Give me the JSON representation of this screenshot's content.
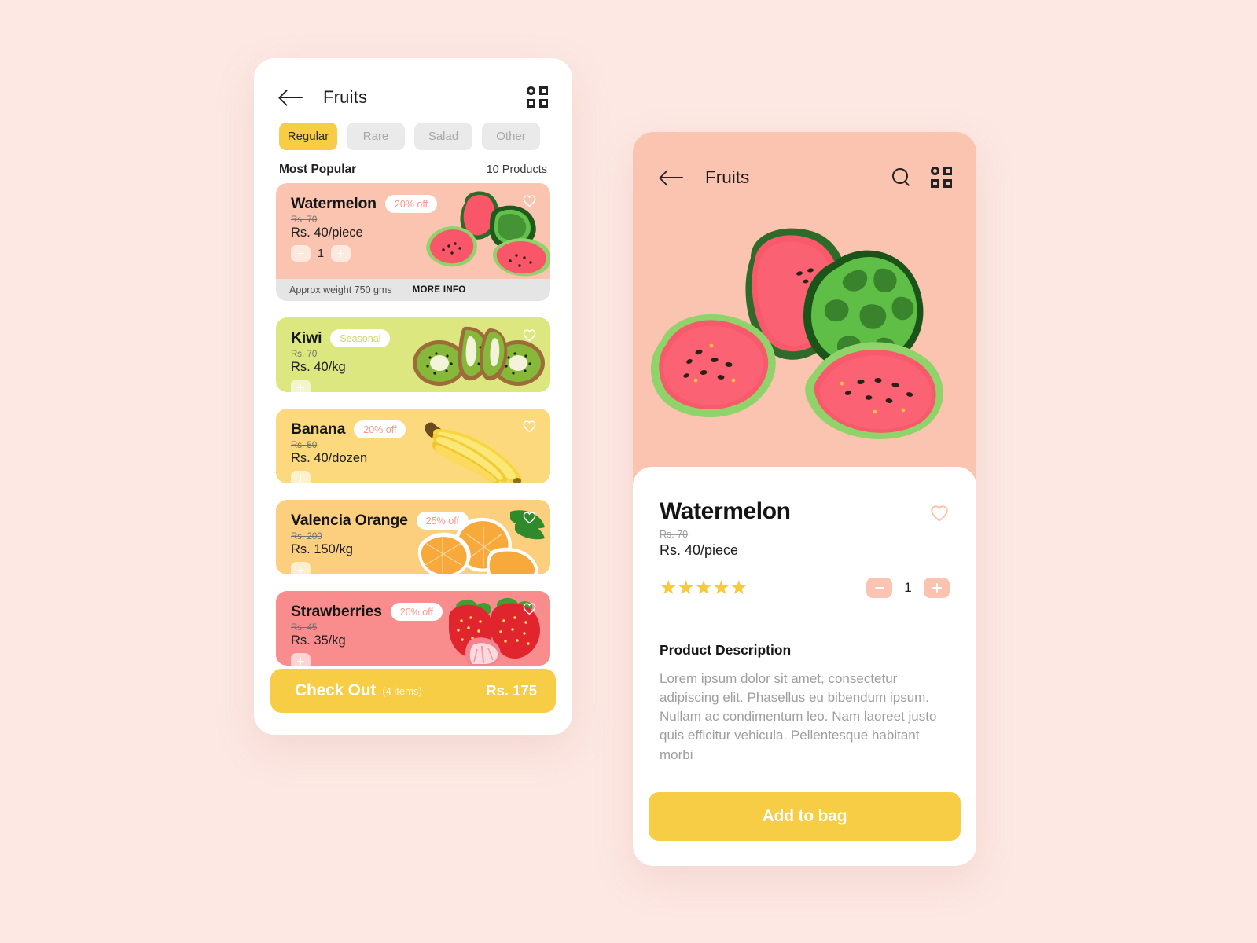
{
  "background_color": "#FDE8E3",
  "list_screen": {
    "back_label": "back-arrow",
    "title": "Fruits",
    "tabs": [
      {
        "label": "Regular",
        "active": true
      },
      {
        "label": "Rare",
        "active": false
      },
      {
        "label": "Salad",
        "active": false
      },
      {
        "label": "Other",
        "active": false
      }
    ],
    "section_title": "Most Popular",
    "product_count": "10 Products",
    "products": [
      {
        "name": "Watermelon",
        "badge": "20% off",
        "badge_type": "off",
        "old_price": "Rs. 70",
        "price": "Rs. 40/piece",
        "quantity": "1",
        "has_stepper": true,
        "card_color": "#FBC4B0",
        "footer": {
          "approx": "Approx weight 750 gms",
          "more_info": "MORE INFO"
        }
      },
      {
        "name": "Kiwi",
        "badge": "Seasonal",
        "badge_type": "seasonal",
        "old_price": "Rs. 70",
        "price": "Rs. 40/kg",
        "has_stepper": false,
        "card_color": "#DCE87F"
      },
      {
        "name": "Banana",
        "badge": "20% off",
        "badge_type": "off",
        "old_price": "Rs. 50",
        "price": "Rs. 40/dozen",
        "has_stepper": false,
        "card_color": "#FBD97C"
      },
      {
        "name": "Valencia Orange",
        "badge": "25% off",
        "badge_type": "off",
        "old_price": "Rs. 200",
        "price": "Rs. 150/kg",
        "has_stepper": false,
        "card_color": "#FCCF7F"
      },
      {
        "name": "Strawberries",
        "badge": "20% off",
        "badge_type": "off",
        "old_price": "Rs. 45",
        "price": "Rs. 35/kg",
        "has_stepper": false,
        "card_color": "#F98C8C"
      }
    ],
    "checkout": {
      "label": "Check Out",
      "items": "(4 items)",
      "total": "Rs. 175",
      "color": "#F7CD46"
    }
  },
  "detail_screen": {
    "title": "Fruits",
    "hero_bg": "#FBC4B0",
    "product_name": "Watermelon",
    "old_price": "Rs. 70",
    "price": "Rs. 40/piece",
    "stars": "★★★★★",
    "star_color": "#F7CA3E",
    "quantity": "1",
    "description_title": "Product Description",
    "description_body": "Lorem ipsum dolor sit amet, consectetur adipiscing elit. Phasellus eu bibendum ipsum. Nullam ac condimentum leo. Nam laoreet justo quis efficitur vehicula. Pellentesque habitant morbi",
    "add_to_bag": "Add to bag",
    "accent_color": "#F7CD46"
  }
}
